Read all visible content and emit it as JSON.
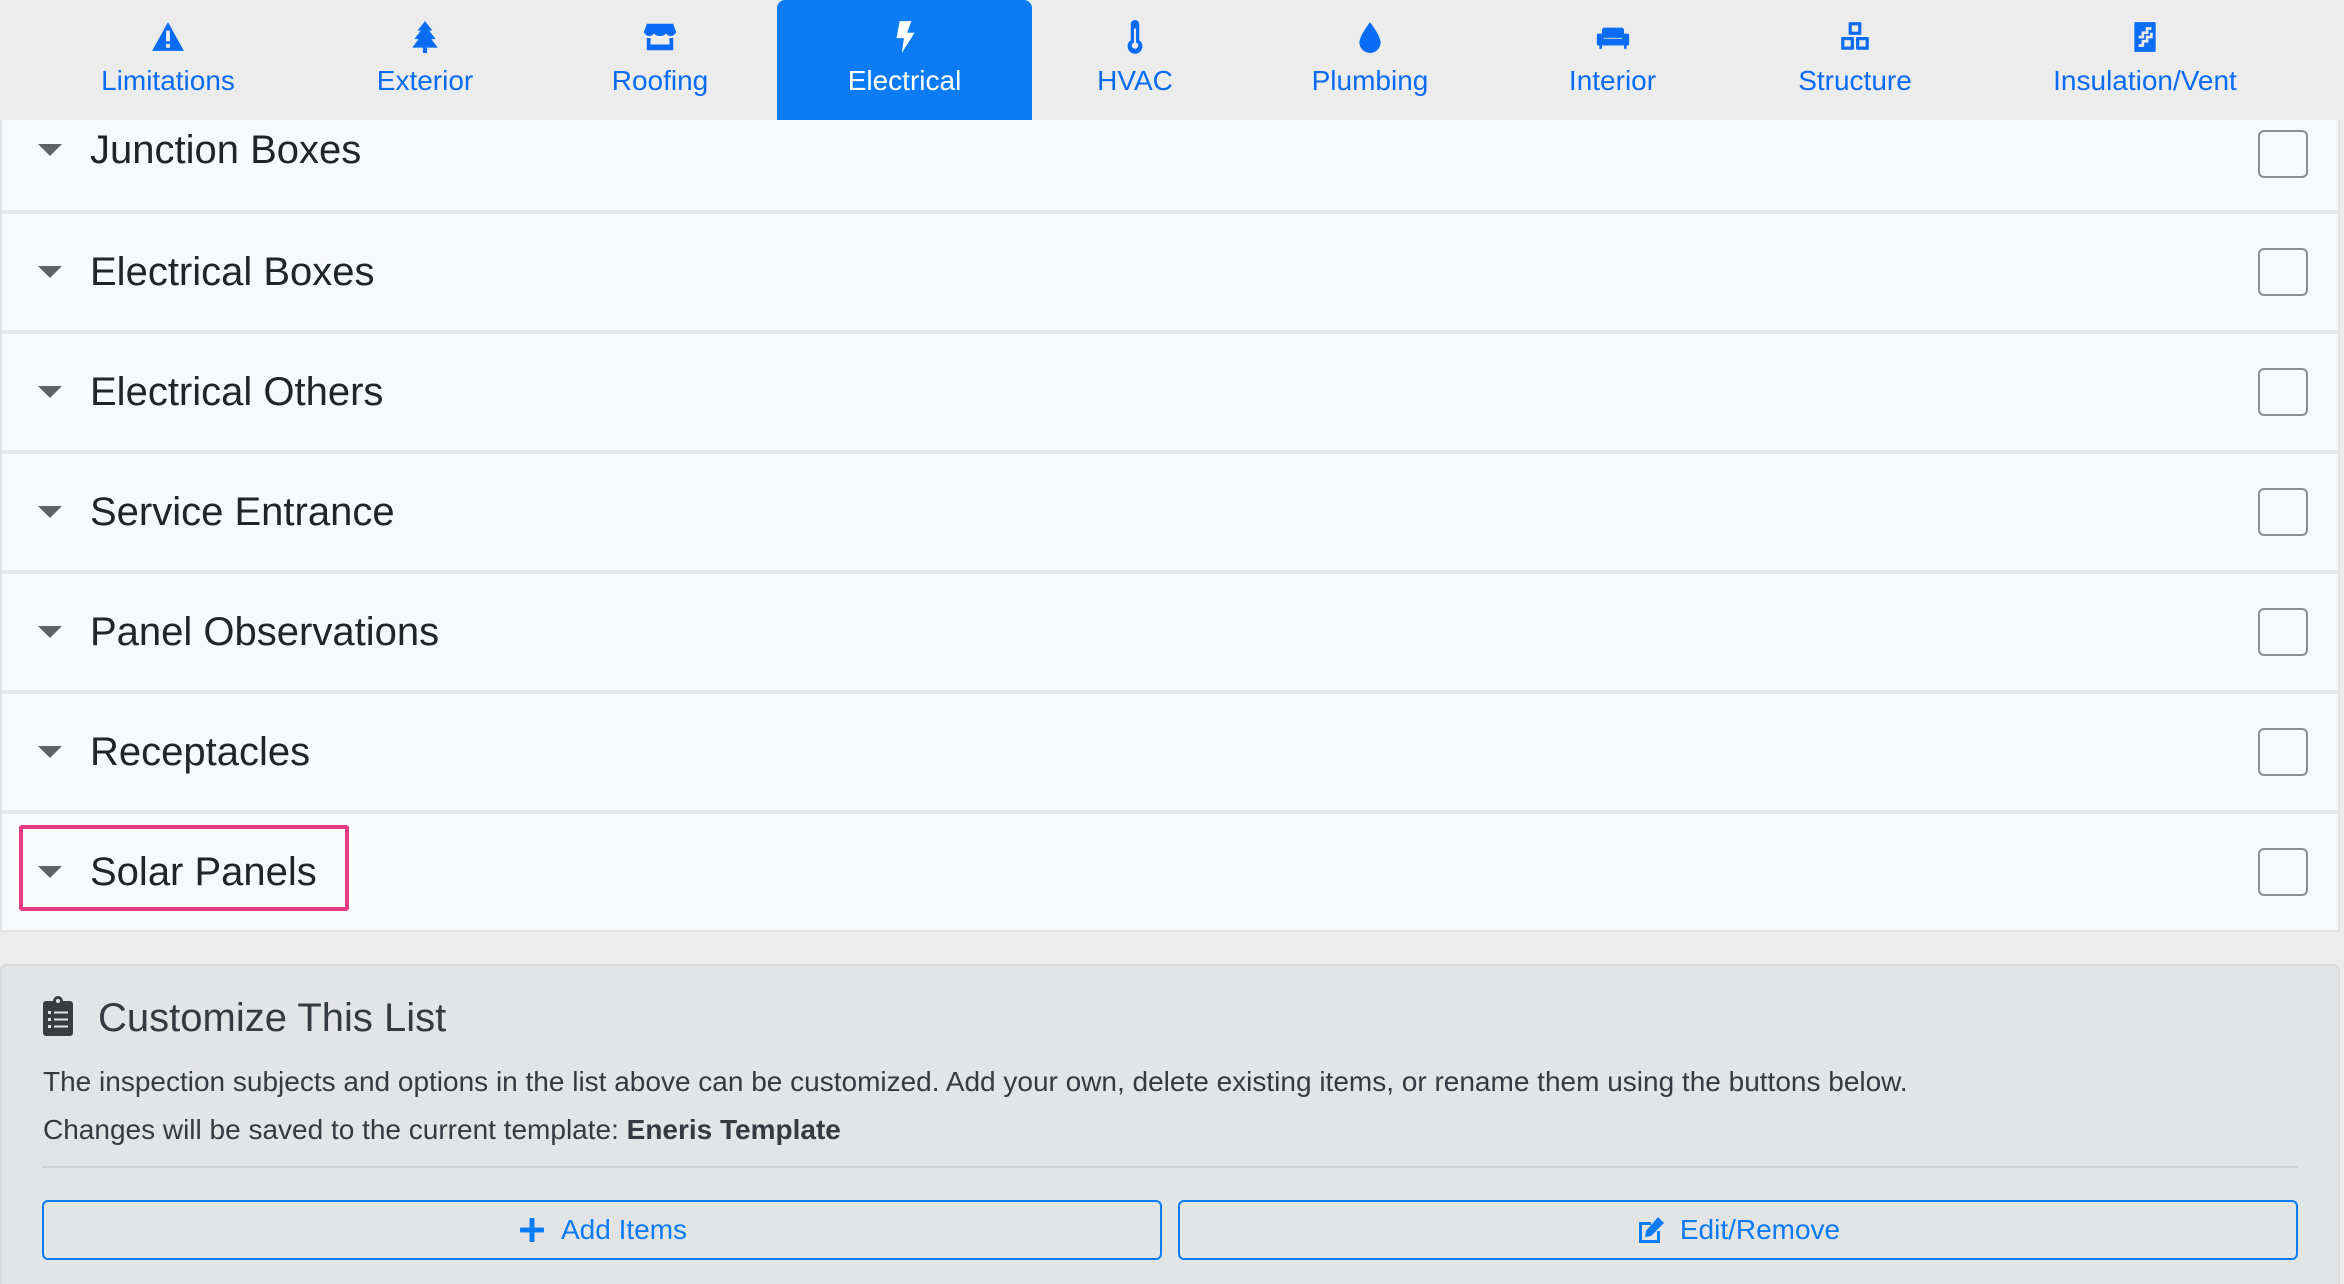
{
  "tabs": [
    {
      "label": "Limitations",
      "icon": "warning-icon"
    },
    {
      "label": "Exterior",
      "icon": "tree-icon"
    },
    {
      "label": "Roofing",
      "icon": "store-icon"
    },
    {
      "label": "Electrical",
      "icon": "bolt-icon",
      "active": true
    },
    {
      "label": "HVAC",
      "icon": "thermometer-icon"
    },
    {
      "label": "Plumbing",
      "icon": "water-drop-icon"
    },
    {
      "label": "Interior",
      "icon": "couch-icon"
    },
    {
      "label": "Structure",
      "icon": "cubes-icon"
    },
    {
      "label": "Insulation/Vent",
      "icon": "insulation-icon"
    }
  ],
  "sections": [
    {
      "title": "Junction Boxes",
      "checked": false
    },
    {
      "title": "Electrical Boxes",
      "checked": false
    },
    {
      "title": "Electrical Others",
      "checked": false
    },
    {
      "title": "Service Entrance",
      "checked": false
    },
    {
      "title": "Panel Observations",
      "checked": false
    },
    {
      "title": "Receptacles",
      "checked": false
    },
    {
      "title": "Solar Panels",
      "checked": false
    }
  ],
  "customize": {
    "title": "Customize This List",
    "description": "The inspection subjects and options in the list above can be customized. Add your own, delete existing items, or rename them using the buttons below.",
    "template_prefix": "Changes will be saved to the current template: ",
    "template_name": "Eneris Template",
    "add_label": "Add Items",
    "edit_label": "Edit/Remove"
  },
  "colors": {
    "accent": "#0b7cf6",
    "highlight": "#e63c84"
  }
}
